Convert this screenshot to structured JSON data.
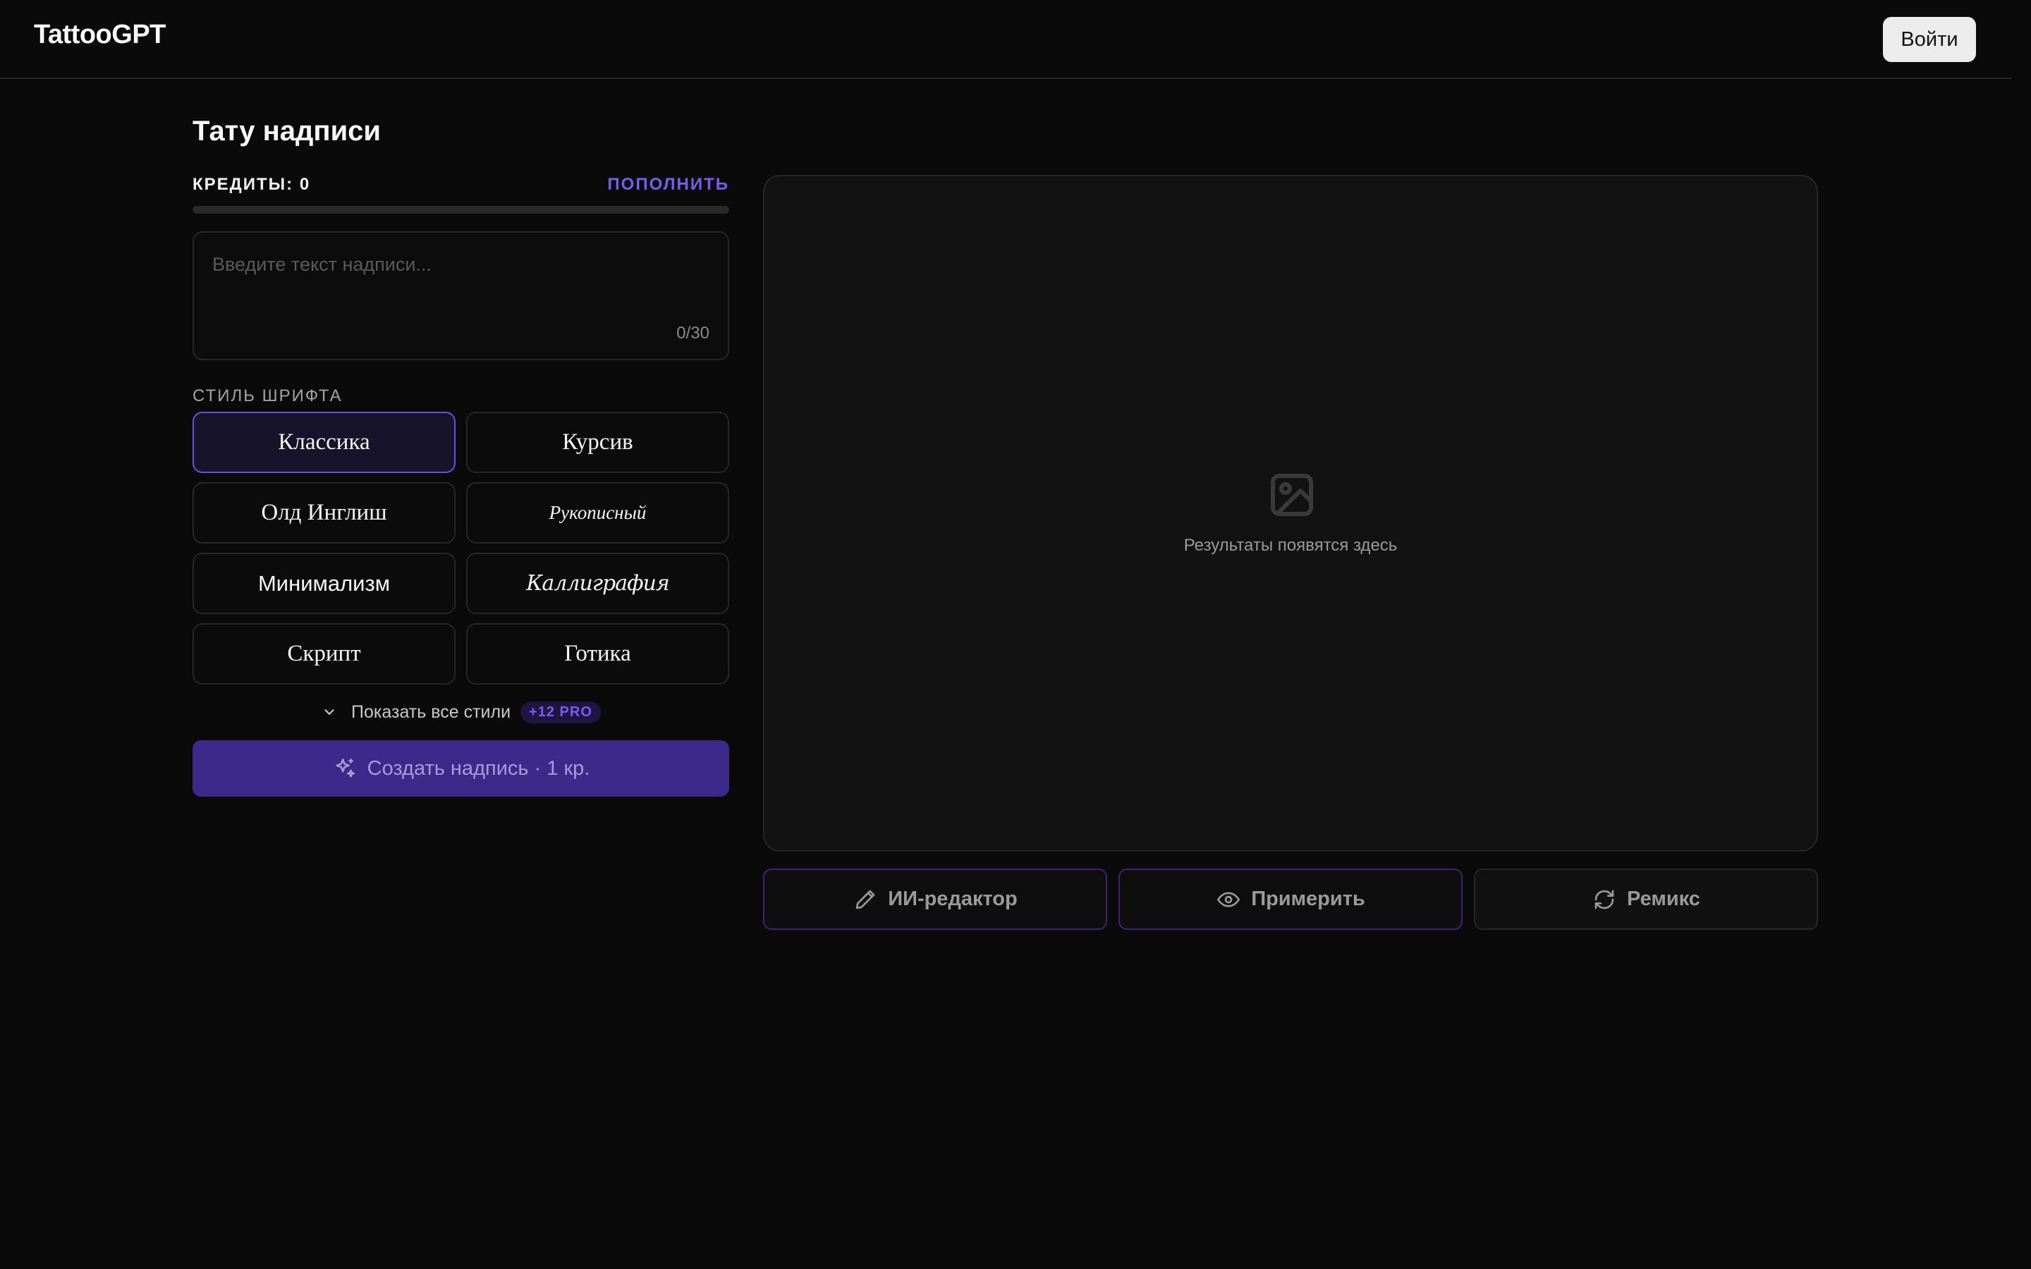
{
  "header": {
    "logo": "TattooGPT",
    "login_label": "Войти"
  },
  "main": {
    "title": "Тату надписи",
    "credits": {
      "label": "КРЕДИТЫ: 0",
      "topup_label": "ПОПОЛНИТЬ",
      "progress": 0
    },
    "input": {
      "value": "",
      "placeholder": "Введите текст надписи...",
      "counter": "0/30"
    },
    "font_style": {
      "label": "СТИЛЬ ШРИФТА",
      "options": [
        {
          "label": "Классика",
          "selected": true
        },
        {
          "label": "Курсив",
          "selected": false
        },
        {
          "label": "Олд Инглиш",
          "selected": false
        },
        {
          "label": "Рукописный",
          "selected": false
        },
        {
          "label": "Минимализм",
          "selected": false
        },
        {
          "label": "Каллиграфия",
          "selected": false
        },
        {
          "label": "Скрипт",
          "selected": false
        },
        {
          "label": "Готика",
          "selected": false
        }
      ],
      "show_all_label": "Показать все стили",
      "pro_badge": "+12 PRO"
    },
    "create_button": "Создать надпись · 1 кр.",
    "result": {
      "placeholder_text": "Результаты появятся здесь",
      "icon": "image-icon"
    },
    "actions": [
      {
        "label": "ИИ-редактор",
        "icon": "pencil-icon"
      },
      {
        "label": "Примерить",
        "icon": "eye-icon"
      },
      {
        "label": "Ремикс",
        "icon": "refresh-icon"
      }
    ]
  },
  "colors": {
    "background": "#0a0a0a",
    "accent": "#7c5cf0",
    "create_button_bg": "#3c2a8a",
    "selected_border": "#6a4fe6"
  }
}
